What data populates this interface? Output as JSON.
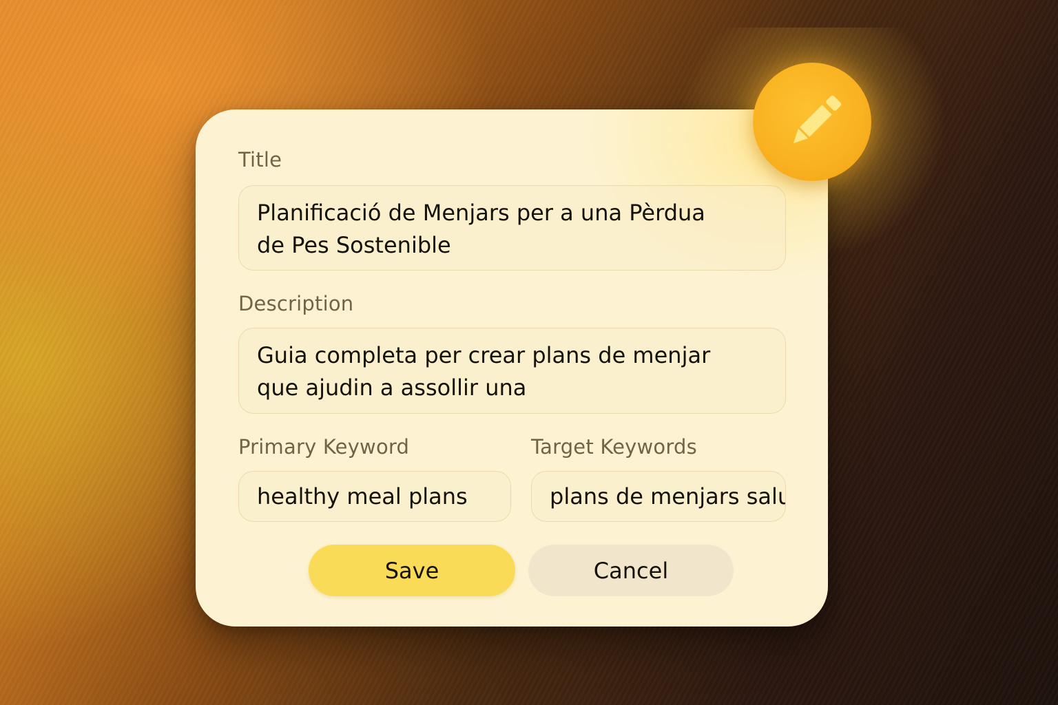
{
  "form": {
    "title_label": "Title",
    "title_value": "Planificació de Menjars per a una Pèrdua\nde Pes Sostenible",
    "description_label": "Description",
    "description_value": "Guia completa per crear plans de menjar\nque ajudin a assollir una",
    "primary_keyword_label": "Primary Keyword",
    "primary_keyword_value": "healthy meal plans",
    "target_keywords_label": "Target Keywords",
    "target_keywords_value": "plans de menjars salu",
    "save_label": "Save",
    "cancel_label": "Cancel"
  },
  "edit_button": {
    "icon": "pencil-icon"
  },
  "colors": {
    "card_background": "#fdf3d2",
    "save_button": "#fadb58",
    "cancel_button": "#f1e6cc",
    "edit_badge": "#f9b120",
    "pencil": "#fde98a"
  }
}
